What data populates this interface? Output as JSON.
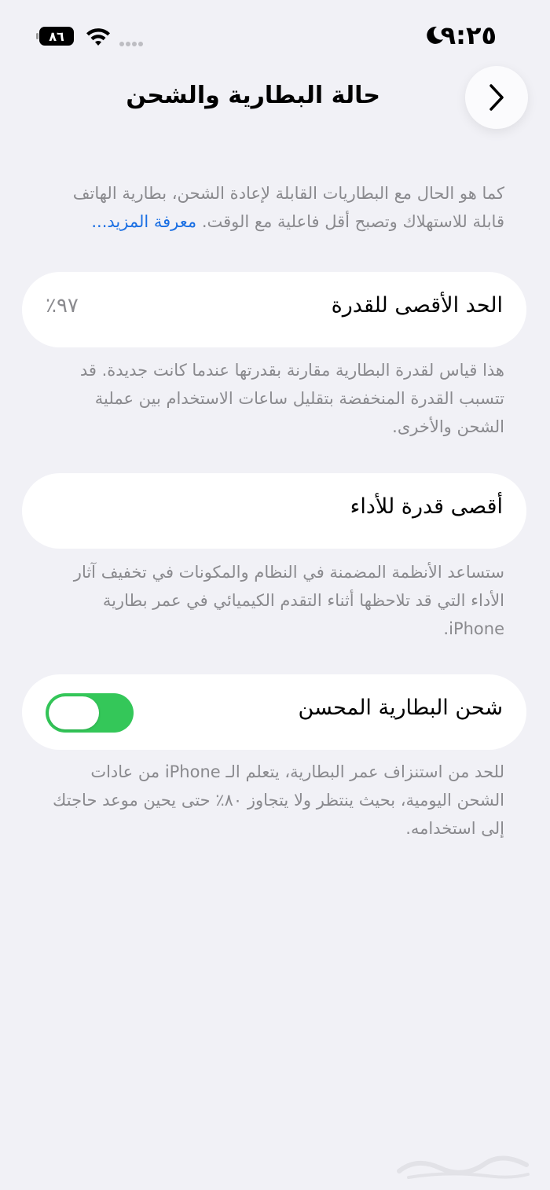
{
  "status_bar": {
    "time": "٩:٢٥",
    "battery_level": "٨٦",
    "icons": [
      "moon-icon",
      "wifi-icon",
      "signal-icon",
      "battery-icon"
    ]
  },
  "nav": {
    "title": "حالة البطارية والشحن",
    "back_icon": "chevron-right-icon"
  },
  "intro": {
    "text": "كما هو الحال مع البطاريات القابلة لإعادة الشحن، بطارية الهاتف قابلة للاستهلاك وتصبح أقل فاعلية مع الوقت.",
    "link": "معرفة المزيد..."
  },
  "max_capacity": {
    "label": "الحد الأقصى للقدرة",
    "value": "٪٩٧",
    "note": "هذا قياس لقدرة البطارية مقارنة بقدرتها عندما كانت جديدة. قد تتسبب القدرة المنخفضة بتقليل ساعات الاستخدام بين عملية الشحن والأخرى."
  },
  "peak_performance": {
    "label": "أقصى قدرة للأداء",
    "note": "ستساعد الأنظمة المضمنة في النظام والمكونات في تخفيف آثار الأداء التي قد تلاحظها أثناء التقدم الكيميائي في عمر بطارية iPhone."
  },
  "optimized_charging": {
    "label": "شحن البطارية المحسن",
    "enabled": true,
    "note": "للحد من استنزاف عمر البطارية، يتعلم الـ iPhone من عادات الشحن اليومية، بحيث ينتظر ولا يتجاوز ٨٠٪ حتى يحين موعد حاجتك إلى استخدامه."
  },
  "colors": {
    "background": "#f1f1f6",
    "toggle_on": "#34c759",
    "link": "#1a6fe3",
    "secondary_text": "#8a8a8e"
  }
}
